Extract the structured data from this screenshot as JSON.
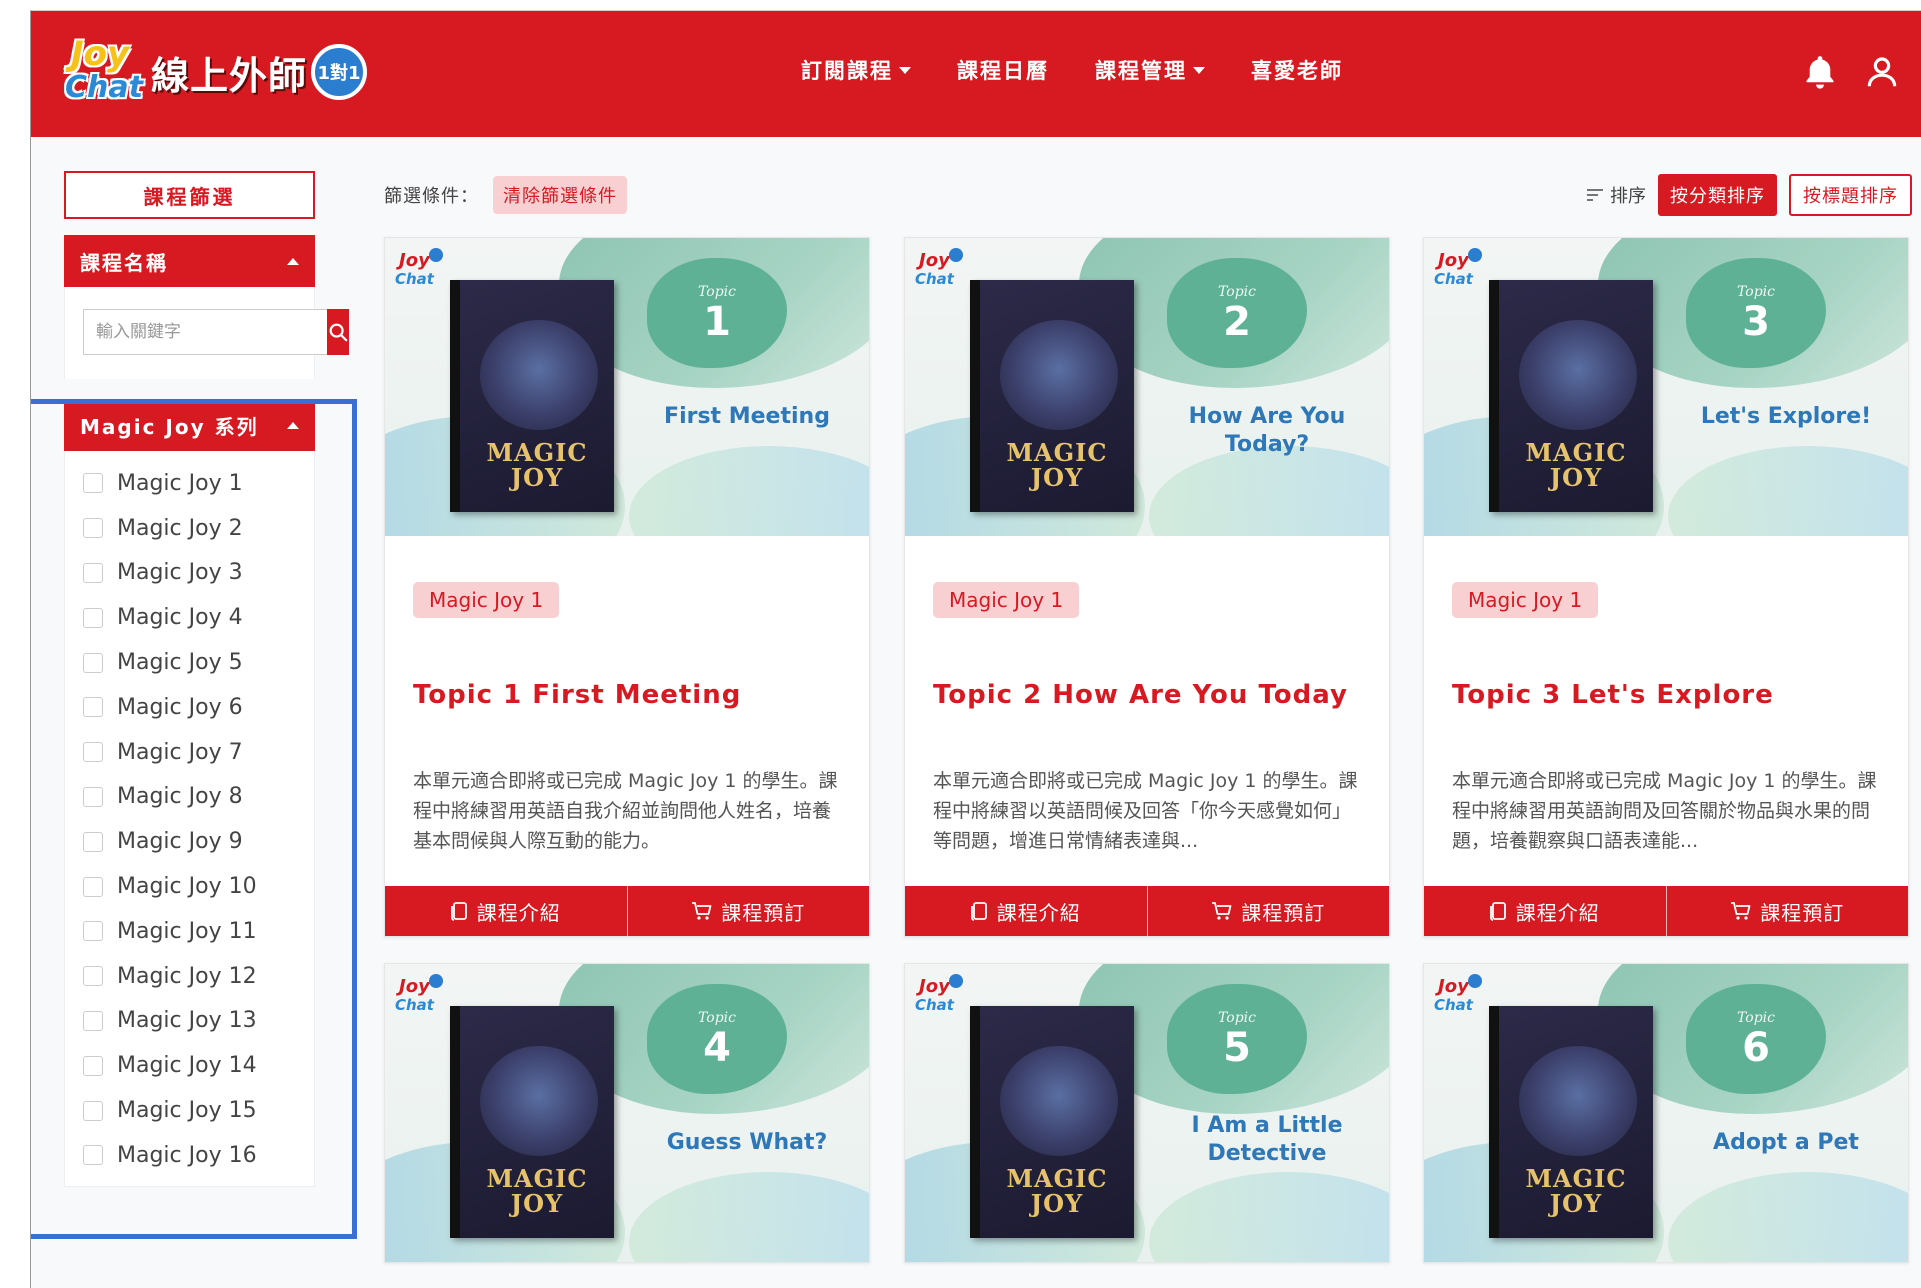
{
  "header": {
    "logo_joy_top": "Joy",
    "logo_joy_bottom": "Chat",
    "logo_text": "線上外師",
    "logo_badge": "1對1",
    "nav": [
      {
        "label": "訂閱課程",
        "dropdown": true
      },
      {
        "label": "課程日曆",
        "dropdown": false
      },
      {
        "label": "課程管理",
        "dropdown": true
      },
      {
        "label": "喜愛老師",
        "dropdown": false
      }
    ],
    "icons": [
      "bell-icon",
      "user-icon"
    ]
  },
  "sidebar": {
    "filter_title": "課程篩選",
    "name_panel_label": "課程名稱",
    "search_placeholder": "輸入關鍵字",
    "series_panel_label": "Magic Joy 系列",
    "series_items": [
      "Magic Joy 1",
      "Magic Joy 2",
      "Magic Joy 3",
      "Magic Joy 4",
      "Magic Joy 5",
      "Magic Joy 6",
      "Magic Joy 7",
      "Magic Joy 8",
      "Magic Joy 9",
      "Magic Joy 10",
      "Magic Joy 11",
      "Magic Joy 12",
      "Magic Joy 13",
      "Magic Joy 14",
      "Magic Joy 15",
      "Magic Joy 16"
    ]
  },
  "toolbar": {
    "filter_label": "篩選條件：",
    "clear_label": "清除篩選條件",
    "sort_label": "排序",
    "sort_by_category": "按分類排序",
    "sort_by_title": "按標題排序"
  },
  "book": {
    "title_line1": "MAGIC",
    "title_line2": "JOY"
  },
  "card_buttons": {
    "intro": "課程介紹",
    "book": "課程預訂"
  },
  "topic_word": "Topic",
  "courses": [
    {
      "num": "1",
      "cover_title": "First Meeting",
      "tag": "Magic Joy 1",
      "title": "Topic 1 First Meeting",
      "desc": "本單元適合即將或已完成 Magic Joy 1 的學生。課程中將練習用英語自我介紹並詢問他人姓名，培養基本問候與人際互動的能力。"
    },
    {
      "num": "2",
      "cover_title": "How Are You Today?",
      "tag": "Magic Joy 1",
      "title": "Topic 2 How Are You Today",
      "desc": "本單元適合即將或已完成 Magic Joy 1 的學生。課程中將練習以英語問候及回答「你今天感覺如何」等問題，增進日常情緒表達與..."
    },
    {
      "num": "3",
      "cover_title": "Let's Explore!",
      "tag": "Magic Joy 1",
      "title": "Topic 3 Let's Explore",
      "desc": "本單元適合即將或已完成 Magic Joy 1 的學生。課程中將練習用英語詢問及回答關於物品與水果的問題，培養觀察與口語表達能..."
    },
    {
      "num": "4",
      "cover_title": "Guess What?"
    },
    {
      "num": "5",
      "cover_title": "I Am a Little Detective"
    },
    {
      "num": "6",
      "cover_title": "Adopt a Pet"
    }
  ]
}
